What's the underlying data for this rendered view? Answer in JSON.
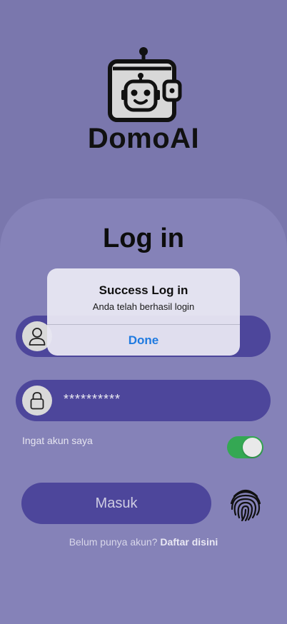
{
  "app": {
    "logo_text": "DomoAI"
  },
  "login": {
    "title": "Log in",
    "username_value": "",
    "password_value": "**********",
    "remember_label": "Ingat akun saya",
    "remember_on": true,
    "submit_label": "Masuk",
    "signup_prompt": "Belum punya akun?",
    "signup_link": "Daftar disini"
  },
  "alert": {
    "title": "Success Log in",
    "message": "Anda telah berhasil login",
    "button_label": "Done"
  },
  "icons": {
    "logo": "robot-wallet-icon",
    "username": "user-icon",
    "password": "lock-icon",
    "biometric": "fingerprint-icon"
  },
  "colors": {
    "background": "#7a77ad",
    "card": "#8582b8",
    "field": "#4d469b",
    "toggle_on": "#34a853",
    "alert_action": "#1f7ae0"
  }
}
